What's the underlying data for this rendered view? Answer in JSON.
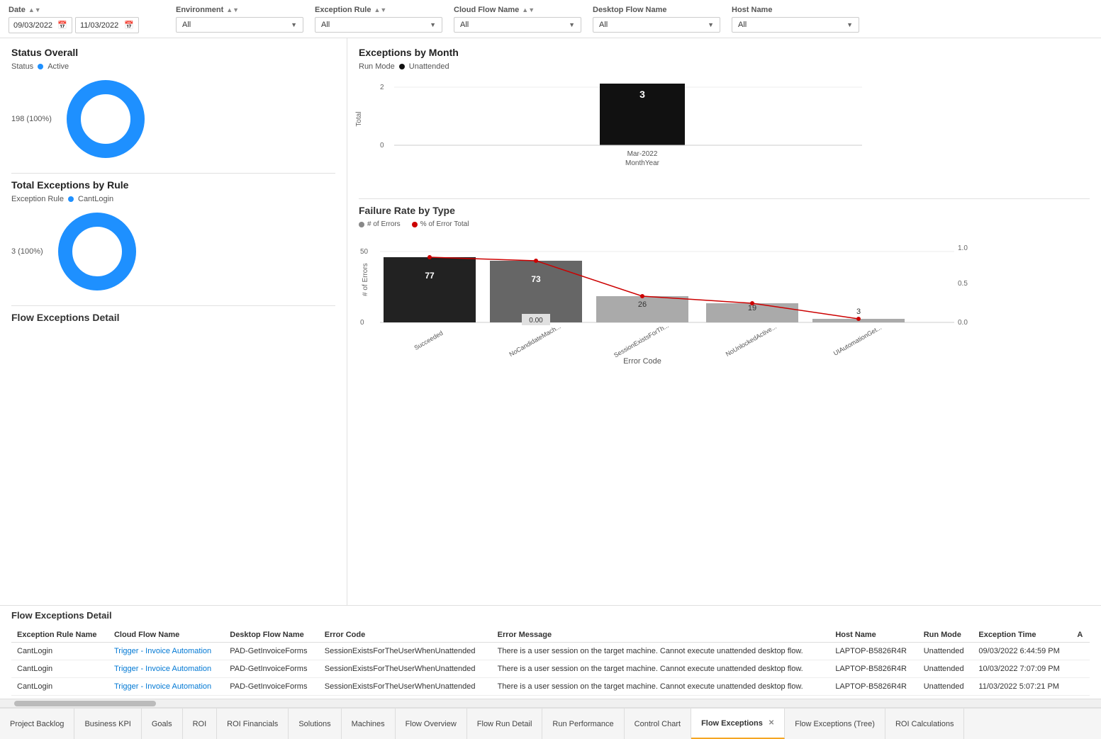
{
  "filters": {
    "date_label": "Date",
    "date_start": "09/03/2022",
    "date_end": "11/03/2022",
    "environment_label": "Environment",
    "environment_value": "All",
    "exception_rule_label": "Exception Rule",
    "exception_rule_value": "All",
    "cloud_flow_label": "Cloud Flow Name",
    "cloud_flow_value": "All",
    "desktop_flow_label": "Desktop Flow Name",
    "desktop_flow_value": "All",
    "host_name_label": "Host Name",
    "host_name_value": "All"
  },
  "status_overall": {
    "title": "Status Overall",
    "status_label": "Status",
    "status_value": "Active",
    "donut_label": "198 (100%)",
    "donut_value": 100
  },
  "exceptions_by_month": {
    "title": "Exceptions by Month",
    "run_mode_label": "Run Mode",
    "run_mode_value": "Unattended",
    "bar_value": "3",
    "month_label": "Mar-2022",
    "x_axis_label": "MonthYear",
    "y_axis_label": "Total",
    "y_values": [
      "2",
      "0"
    ]
  },
  "total_exceptions": {
    "title": "Total Exceptions by Rule",
    "exception_rule_label": "Exception Rule",
    "exception_rule_value": "CantLogin",
    "donut_label": "3 (100%)",
    "donut_value": 100
  },
  "failure_rate": {
    "title": "Failure Rate by Type",
    "legend": [
      {
        "label": "# of Errors",
        "color": "#888"
      },
      {
        "label": "% of Error Total",
        "color": "#c00"
      }
    ],
    "y_axis_label": "# of Errors",
    "y_values": [
      "50",
      "0"
    ],
    "y2_values": [
      "1.0",
      "0.5",
      "0.0"
    ],
    "x_axis_label": "Error Code",
    "bars": [
      {
        "label": "Succeeded",
        "value": 77,
        "color": "#222",
        "pct": null
      },
      {
        "label": "NoCandidateMach...",
        "value": 73,
        "color": "#888",
        "pct": "0.00"
      },
      {
        "label": "SessionExistsForTh...",
        "value": 26,
        "color": "#aaa",
        "pct": null
      },
      {
        "label": "NoUnlockedActive...",
        "value": 19,
        "color": "#aaa",
        "pct": null
      },
      {
        "label": "UIAutomationGet...",
        "value": 3,
        "color": "#aaa",
        "pct": null
      }
    ]
  },
  "flow_exceptions_detail": {
    "title": "Flow Exceptions Detail",
    "columns": [
      "Exception Rule Name",
      "Cloud Flow Name",
      "Desktop Flow Name",
      "Error Code",
      "Error Message",
      "Host Name",
      "Run Mode",
      "Exception Time",
      "A"
    ],
    "rows": [
      {
        "exception_rule": "CantLogin",
        "cloud_flow": "Trigger - Invoice Automation",
        "desktop_flow": "PAD-GetInvoiceForms",
        "error_code": "SessionExistsForTheUserWhenUnattended",
        "error_message": "There is a user session on the target machine. Cannot execute unattended desktop flow.",
        "host_name": "LAPTOP-B5826R4R",
        "run_mode": "Unattended",
        "exception_time": "09/03/2022 6:44:59 PM"
      },
      {
        "exception_rule": "CantLogin",
        "cloud_flow": "Trigger - Invoice Automation",
        "desktop_flow": "PAD-GetInvoiceForms",
        "error_code": "SessionExistsForTheUserWhenUnattended",
        "error_message": "There is a user session on the target machine. Cannot execute unattended desktop flow.",
        "host_name": "LAPTOP-B5826R4R",
        "run_mode": "Unattended",
        "exception_time": "10/03/2022 7:07:09 PM"
      },
      {
        "exception_rule": "CantLogin",
        "cloud_flow": "Trigger - Invoice Automation",
        "desktop_flow": "PAD-GetInvoiceForms",
        "error_code": "SessionExistsForTheUserWhenUnattended",
        "error_message": "There is a user session on the target machine. Cannot execute unattended desktop flow.",
        "host_name": "LAPTOP-B5826R4R",
        "run_mode": "Unattended",
        "exception_time": "11/03/2022 5:07:21 PM"
      }
    ]
  },
  "tabs": [
    {
      "label": "Project Backlog",
      "active": false,
      "closable": false
    },
    {
      "label": "Business KPI",
      "active": false,
      "closable": false
    },
    {
      "label": "Goals",
      "active": false,
      "closable": false
    },
    {
      "label": "ROI",
      "active": false,
      "closable": false
    },
    {
      "label": "ROI Financials",
      "active": false,
      "closable": false
    },
    {
      "label": "Solutions",
      "active": false,
      "closable": false
    },
    {
      "label": "Machines",
      "active": false,
      "closable": false
    },
    {
      "label": "Flow Overview",
      "active": false,
      "closable": false
    },
    {
      "label": "Flow Run Detail",
      "active": false,
      "closable": false
    },
    {
      "label": "Run Performance",
      "active": false,
      "closable": false
    },
    {
      "label": "Control Chart",
      "active": false,
      "closable": false
    },
    {
      "label": "Flow Exceptions",
      "active": true,
      "closable": true
    },
    {
      "label": "Flow Exceptions (Tree)",
      "active": false,
      "closable": false
    },
    {
      "label": "ROI Calculations",
      "active": false,
      "closable": false
    }
  ]
}
